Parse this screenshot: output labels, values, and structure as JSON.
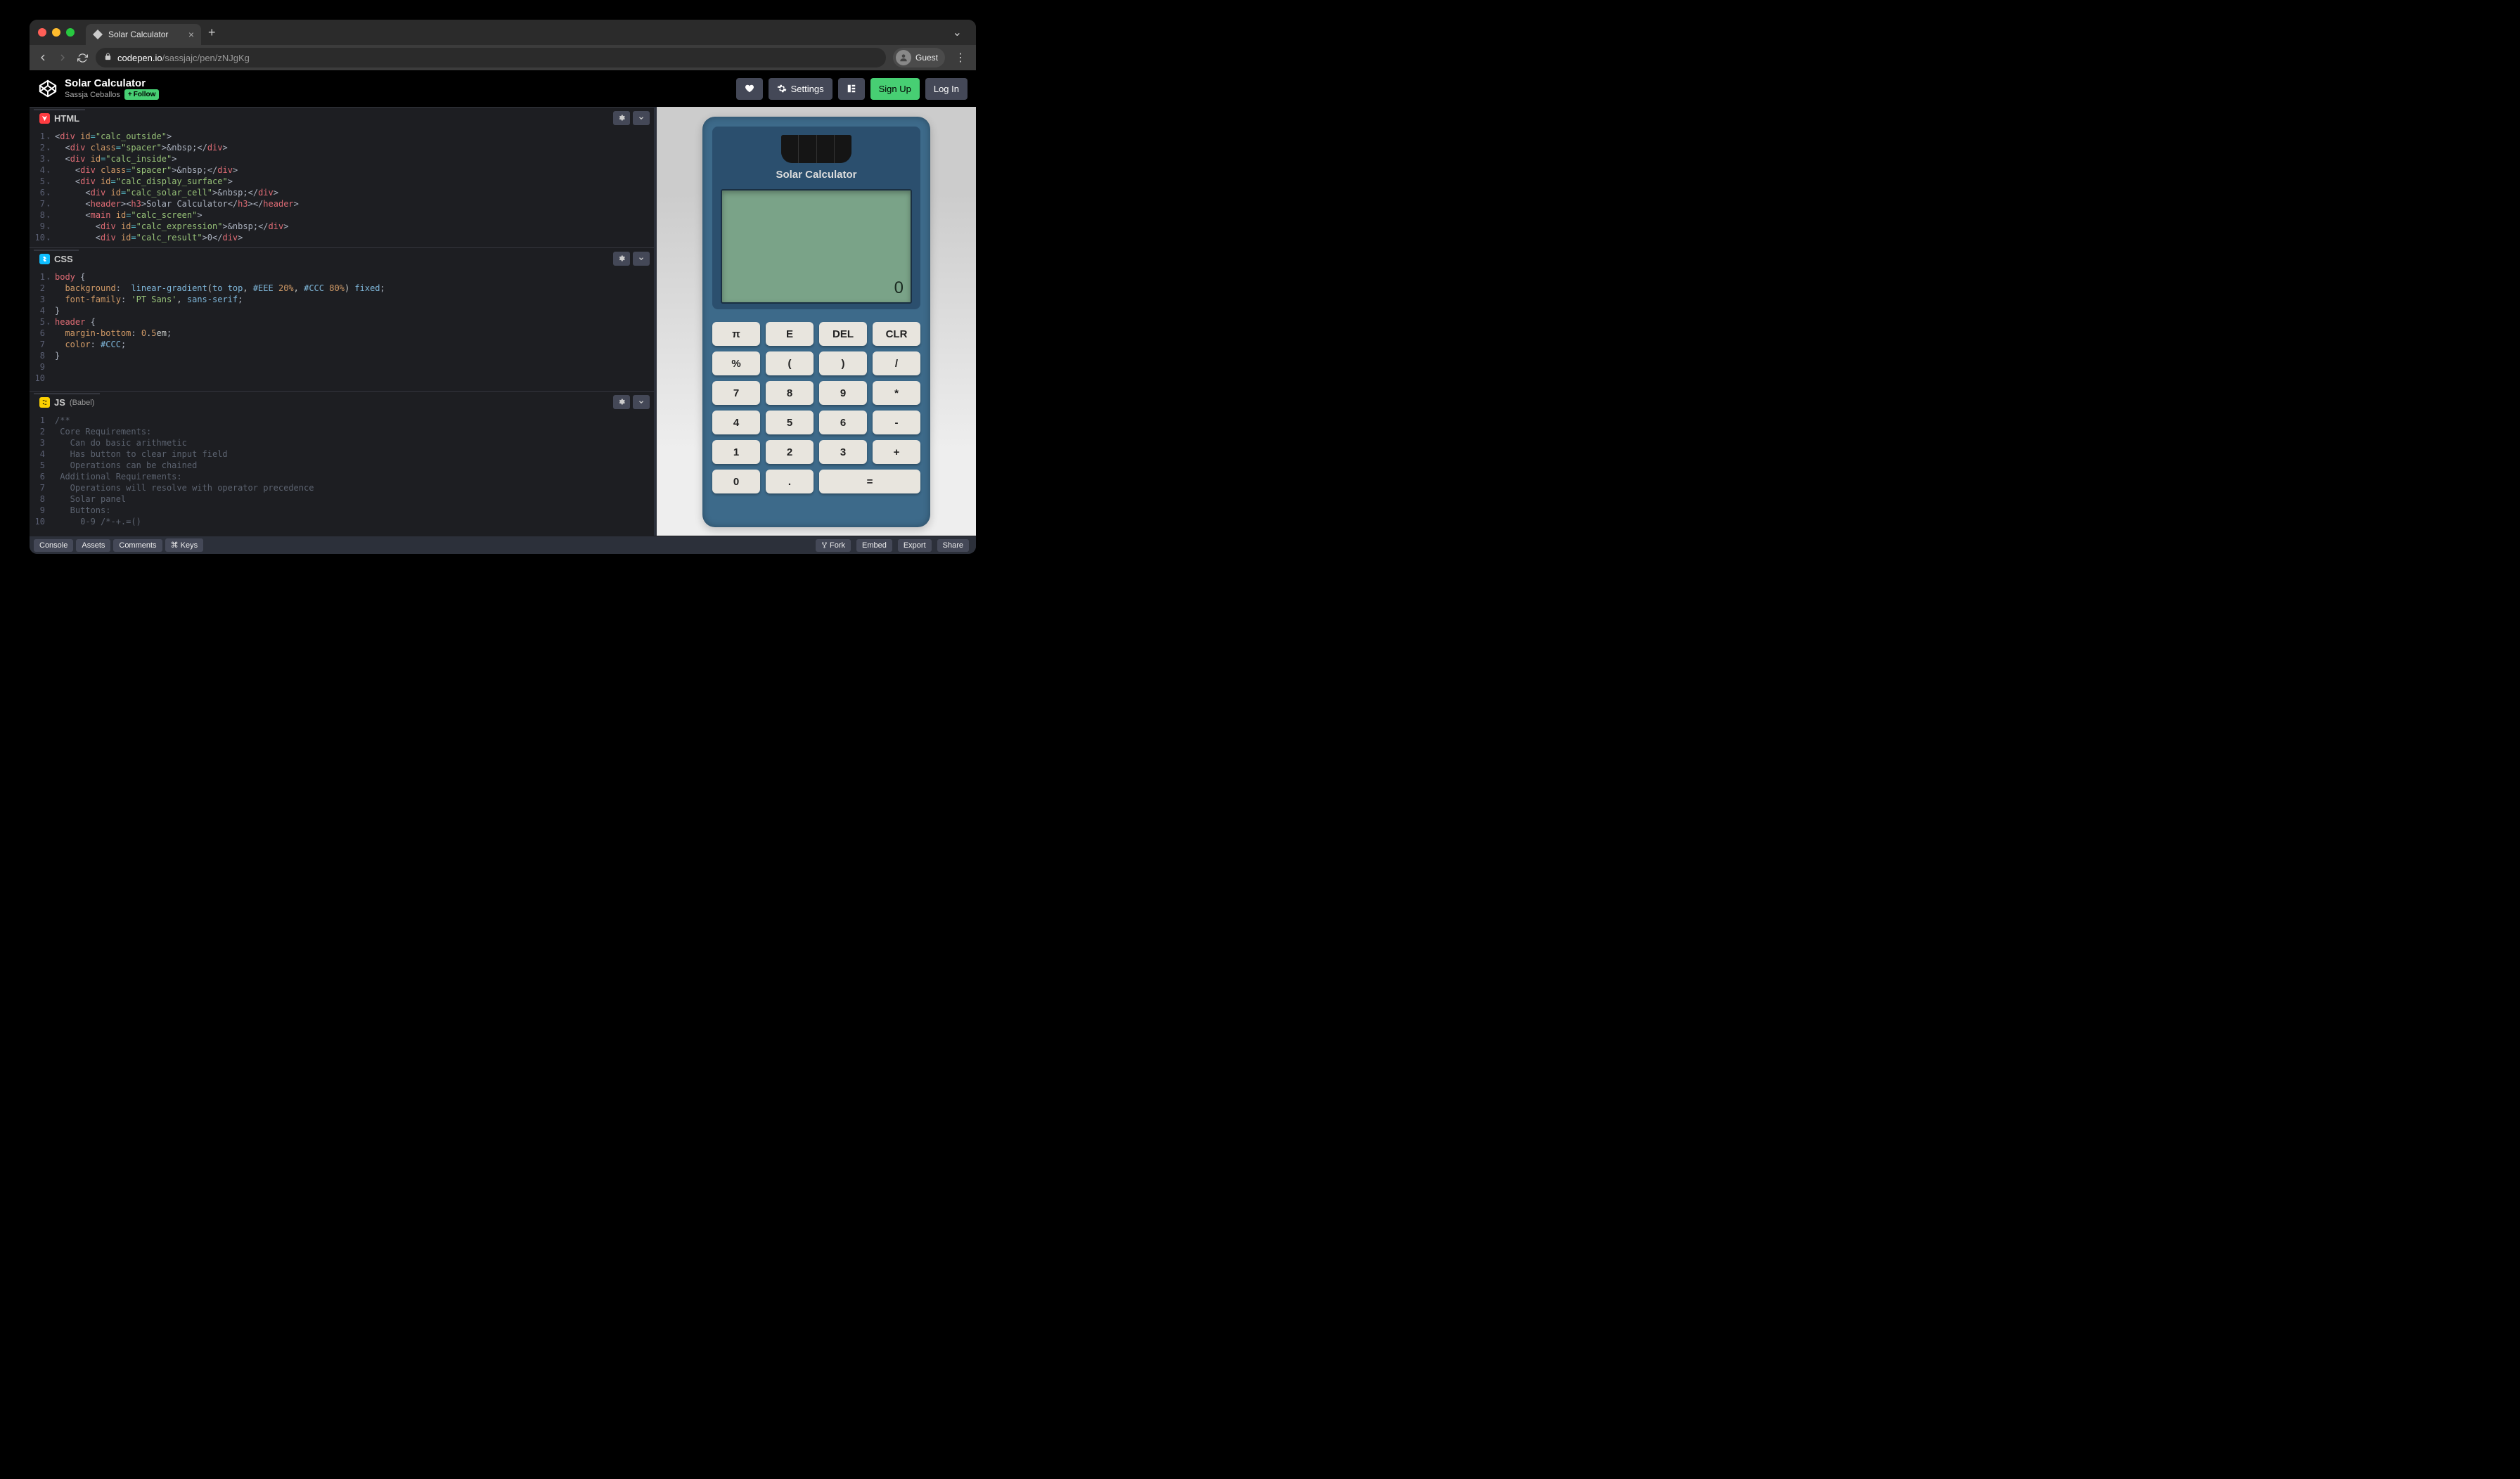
{
  "browser": {
    "tab_title": "Solar Calculator",
    "url_host": "codepen.io",
    "url_path": "/sassjajc/pen/zNJgKg",
    "guest_label": "Guest"
  },
  "cp": {
    "pen_title": "Solar Calculator",
    "author": "Sassja Ceballos",
    "follow_label": "Follow",
    "settings_label": "Settings",
    "signup_label": "Sign Up",
    "login_label": "Log In"
  },
  "panels": {
    "html_label": "HTML",
    "css_label": "CSS",
    "js_label": "JS",
    "js_sublabel": "(Babel)"
  },
  "code": {
    "html_lines": [
      "<div id=\"calc_outside\">",
      "  <div class=\"spacer\">&nbsp;</div>",
      "  <div id=\"calc_inside\">",
      "    <div class=\"spacer\">&nbsp;</div>",
      "    <div id=\"calc_display_surface\">",
      "      <div id=\"calc_solar_cell\">&nbsp;</div>",
      "      <header><h3>Solar Calculator</h3></header>",
      "      <main id=\"calc_screen\">",
      "        <div id=\"calc_expression\">&nbsp;</div>",
      "        <div id=\"calc_result\">0</div>"
    ],
    "css_lines": [
      "body {",
      "  background:  linear-gradient(to top, #EEE 20%, #CCC 80%) fixed;",
      "  font-family: 'PT Sans', sans-serif;",
      "}",
      "header {",
      "  margin-bottom: 0.5em;",
      "  color: #CCC;",
      "}",
      "",
      ""
    ],
    "js_lines": [
      "/**",
      " Core Requirements:",
      "   Can do basic arithmetic",
      "   Has button to clear input field",
      "   Operations can be chained",
      " Additional Requirements:",
      "   Operations will resolve with operator precedence",
      "   Solar panel",
      "   Buttons:",
      "     0-9 /*-+.=()"
    ]
  },
  "calculator": {
    "title": "Solar Calculator",
    "expression": "",
    "result": "0",
    "buttons": [
      {
        "label": "π"
      },
      {
        "label": "E"
      },
      {
        "label": "DEL"
      },
      {
        "label": "CLR"
      },
      {
        "label": "%"
      },
      {
        "label": "("
      },
      {
        "label": ")"
      },
      {
        "label": "/"
      },
      {
        "label": "7"
      },
      {
        "label": "8"
      },
      {
        "label": "9"
      },
      {
        "label": "*"
      },
      {
        "label": "4"
      },
      {
        "label": "5"
      },
      {
        "label": "6"
      },
      {
        "label": "-"
      },
      {
        "label": "1"
      },
      {
        "label": "2"
      },
      {
        "label": "3"
      },
      {
        "label": "+"
      },
      {
        "label": "0"
      },
      {
        "label": "."
      },
      {
        "label": "=",
        "wide": true
      }
    ]
  },
  "footer": {
    "console": "Console",
    "assets": "Assets",
    "comments": "Comments",
    "keys": "⌘ Keys",
    "fork": "Fork",
    "embed": "Embed",
    "export": "Export",
    "share": "Share"
  }
}
